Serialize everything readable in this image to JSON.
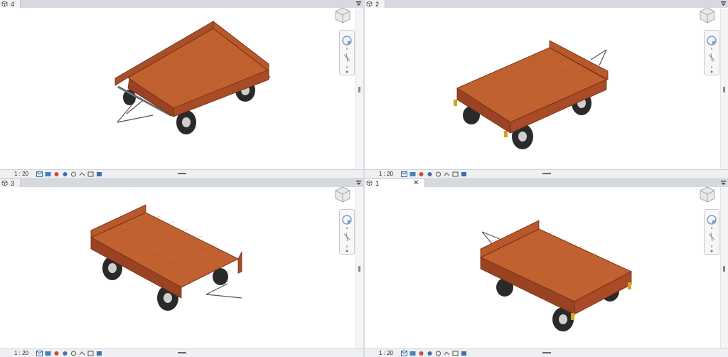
{
  "viewports": [
    {
      "id": "vp-4",
      "tab_label": "4",
      "closable": false,
      "scale": "1 : 20",
      "view": "a"
    },
    {
      "id": "vp-2",
      "tab_label": "2",
      "closable": false,
      "scale": "1 : 20",
      "view": "b"
    },
    {
      "id": "vp-3",
      "tab_label": "3",
      "closable": false,
      "scale": "1 : 20",
      "view": "c"
    },
    {
      "id": "vp-1",
      "tab_label": "1",
      "closable": true,
      "scale": "1 : 20",
      "view": "d"
    }
  ],
  "tab_close_glyph": "✕",
  "status_tools": [
    "detail-level-icon",
    "visual-style-icon",
    "sun-path-icon",
    "shadows-icon",
    "render-icon",
    "crop-view-icon",
    "show-crop-icon",
    "hide-isolate-icon",
    "reveal-hidden-icon"
  ],
  "colors": {
    "wood": "#b5532a",
    "wood_dark": "#8a3a1c",
    "wood_light": "#c86a3c",
    "frame": "#6b6f74",
    "tire": "#2a2a2a",
    "rim": "#cfcfcf",
    "taillight": "#d9a11a"
  }
}
